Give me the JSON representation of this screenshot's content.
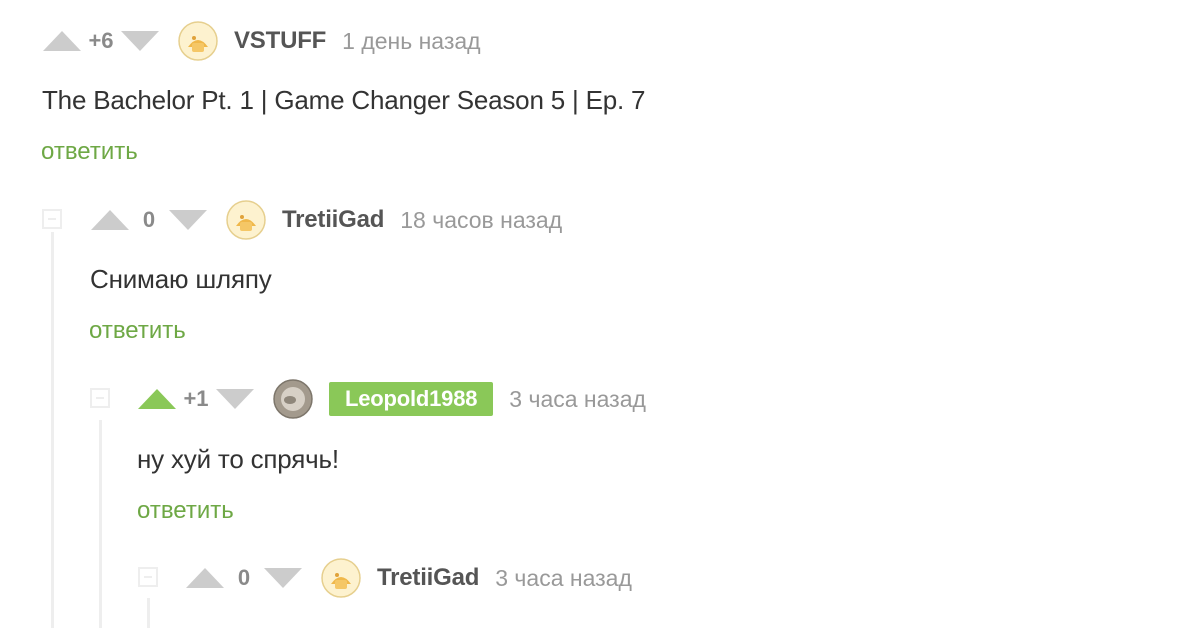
{
  "comments": [
    {
      "rating": "+6",
      "username": "VSTUFF",
      "time": "1 день назад",
      "text": "The Bachelor Pt. 1 | Game Changer Season 5 | Ep. 7",
      "reply_label": "ответить",
      "upvoted": false
    },
    {
      "rating": "0",
      "username": "TretiiGad",
      "time": "18 часов назад",
      "text": "Снимаю шляпу",
      "reply_label": "ответить",
      "upvoted": false
    },
    {
      "rating": "+1",
      "username": "Leopold1988",
      "time": "3 часа назад",
      "text": "ну хуй то спрячь!",
      "reply_label": "ответить",
      "upvoted": true
    },
    {
      "rating": "0",
      "username": "TretiiGad",
      "time": "3 часа назад",
      "text": "",
      "reply_label": "",
      "upvoted": false
    }
  ],
  "colors": {
    "accent_green": "#8ac858",
    "reply_green": "#6ea845",
    "arrow_gray": "#cccccc",
    "text": "#333333",
    "muted": "#999999"
  },
  "icons": {
    "vote_up": "triangle-up-icon",
    "vote_down": "triangle-down-icon",
    "collapse": "minus-square-icon"
  }
}
